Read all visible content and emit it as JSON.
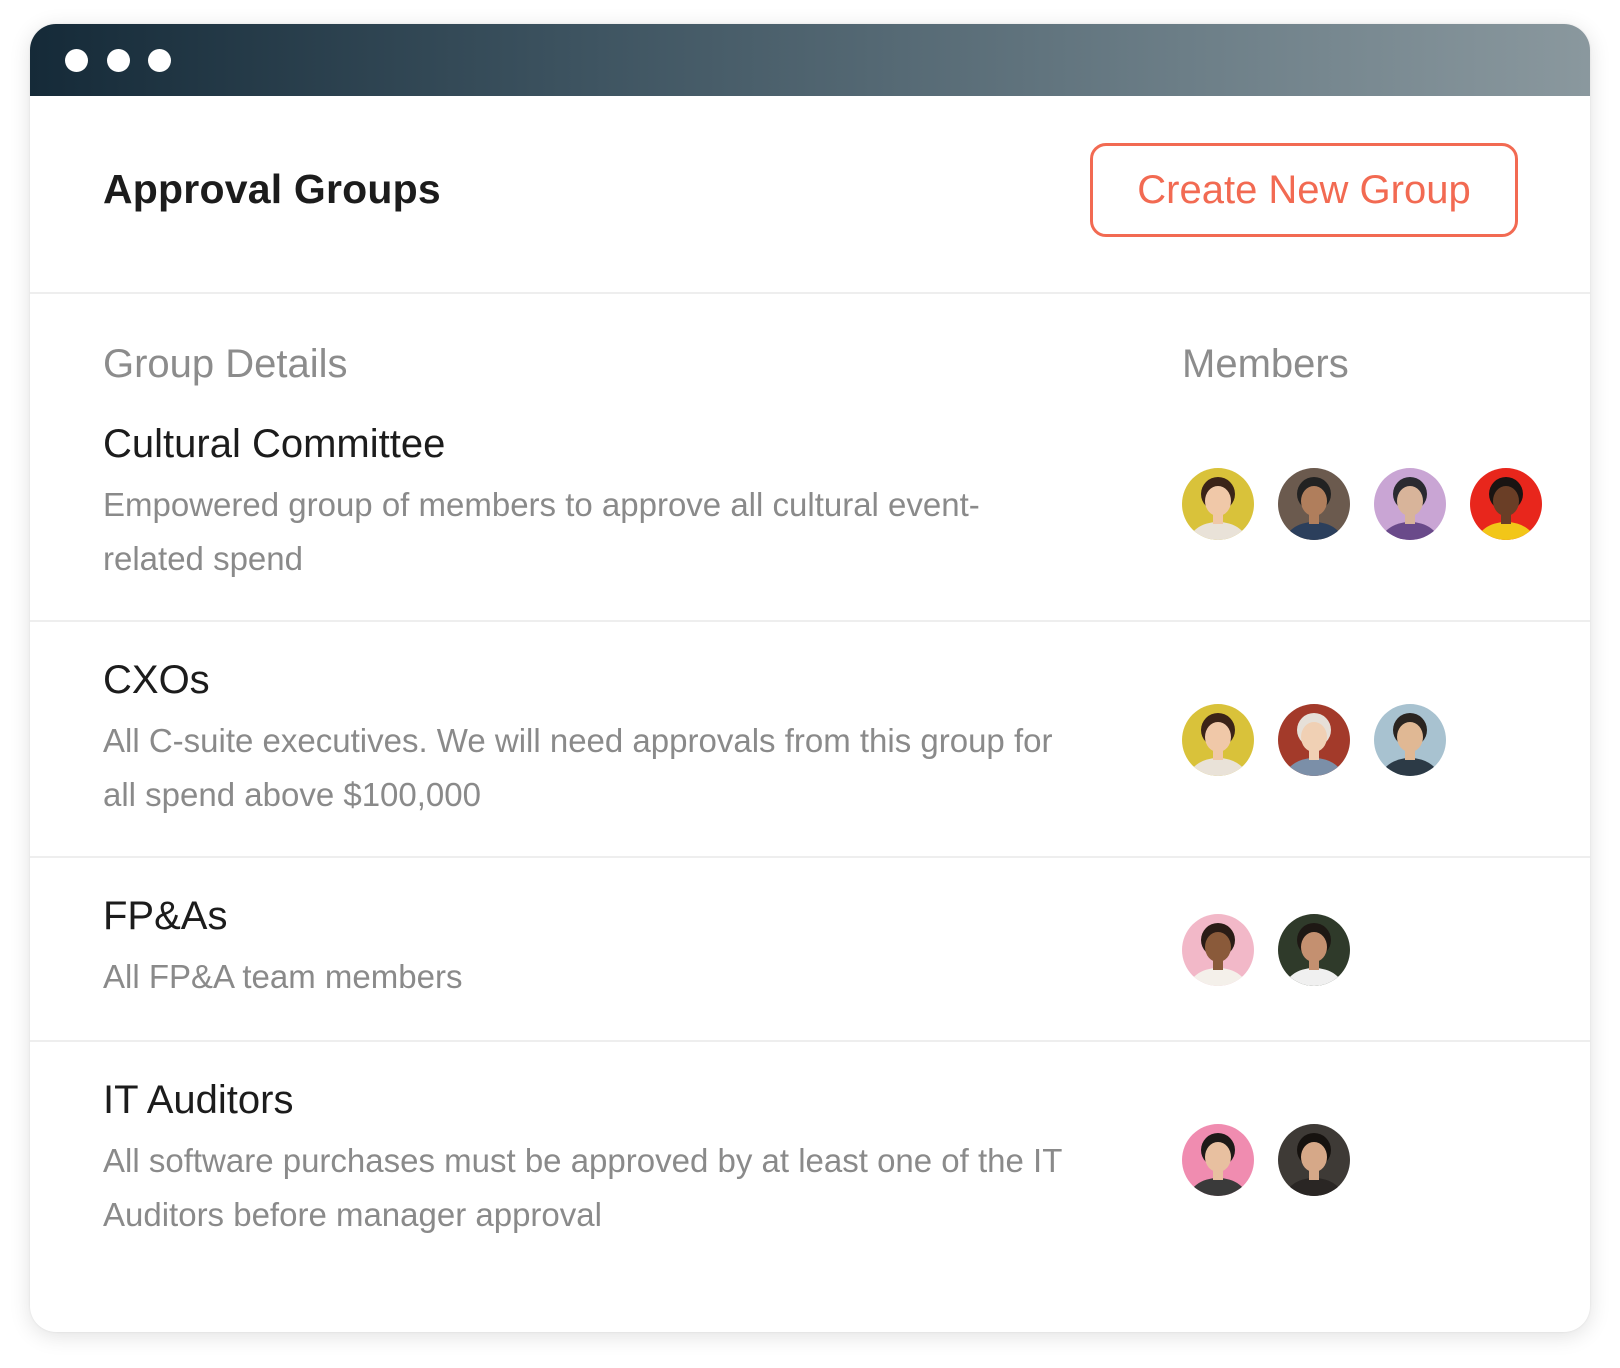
{
  "window": {
    "title_dots": [
      "close",
      "minimize",
      "maximize"
    ]
  },
  "header": {
    "title": "Approval Groups",
    "create_button_label": "Create New Group",
    "accent_color": "#f26a52"
  },
  "table": {
    "columns": [
      "Group Details",
      "Members"
    ],
    "groups": [
      {
        "name": "Cultural Committee",
        "description": "Empowered group of members to approve all cultural event-related spend",
        "members": [
          {
            "bg": "#d9c23a",
            "skin": "#f0c8a8",
            "hair": "#3b2418",
            "shirt": "#e9e2d8"
          },
          {
            "bg": "#6b5a4e",
            "skin": "#b07e5c",
            "hair": "#222222",
            "shirt": "#2b3f5c"
          },
          {
            "bg": "#c9a5d4",
            "skin": "#d8b49a",
            "hair": "#2a2a30",
            "shirt": "#6a4a8a"
          },
          {
            "bg": "#e8261c",
            "skin": "#6a3e26",
            "hair": "#1a1412",
            "shirt": "#f2c618"
          }
        ]
      },
      {
        "name": "CXOs",
        "description": "All C-suite executives. We will need approvals from this group for all spend above $100,000",
        "members": [
          {
            "bg": "#d9c23a",
            "skin": "#f0c8a8",
            "hair": "#3b2418",
            "shirt": "#e9e2d8"
          },
          {
            "bg": "#a33a2a",
            "skin": "#f0d0b4",
            "hair": "#e6e0d8",
            "shirt": "#7b8fa8"
          },
          {
            "bg": "#a8c2d0",
            "skin": "#e0b894",
            "hair": "#2a2420",
            "shirt": "#2c3a46"
          }
        ]
      },
      {
        "name": "FP&As",
        "description": "All FP&A team members",
        "members": [
          {
            "bg": "#f2b8c8",
            "skin": "#8a5a3a",
            "hair": "#2a1c16",
            "shirt": "#f4f0ea"
          },
          {
            "bg": "#2f3a2a",
            "skin": "#c49070",
            "hair": "#1e1814",
            "shirt": "#f0f0f0"
          }
        ]
      },
      {
        "name": "IT Auditors",
        "description": "All software purchases must be approved by at least one of the IT Auditors before manager approval",
        "members": [
          {
            "bg": "#f08cb0",
            "skin": "#e8c0a0",
            "hair": "#1e1a18",
            "shirt": "#3a3a3a"
          },
          {
            "bg": "#3e3a36",
            "skin": "#d6a888",
            "hair": "#16120f",
            "shirt": "#2a2624"
          }
        ]
      }
    ]
  }
}
